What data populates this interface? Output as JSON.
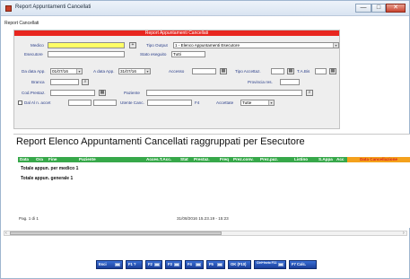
{
  "window": {
    "title": "Report Appuntamenti Cancellati",
    "min": "—",
    "max": "□",
    "close": "✕"
  },
  "subtitle": "Report Cancellati",
  "form": {
    "header": "Report Appuntamenti Cancellati",
    "medico_label": "Medico",
    "medico_value": "",
    "tipo_output_label": "Tipo Output",
    "tipo_output_value": "1 - Elenco Appuntamenti Esecutore",
    "esecutore_label": "Esecutore",
    "esecutore_value": "",
    "stato_label": "Stato eseguito",
    "stato_value": "Tutti",
    "da_data_label": "Da data App.",
    "da_data_value": "01/07/16",
    "a_data_label": "A data App.",
    "a_data_value": "31/07/16",
    "accesso_label": "Accesso",
    "accesso_value": "",
    "tipo_accett_label": "Tipo Accettaz.",
    "tipo_accett_value": "",
    "ta_bis_label": "T.A.Bis",
    "ta_bis_value": "",
    "branca_label": "Branca",
    "branca_value": "",
    "provincia_label": "Provincia res.",
    "provincia_value": "",
    "cod_prestaz_label": "Cod.Prestaz.",
    "cod_prestaz_value": "",
    "paziente_label": "Paziente",
    "paziente_value": "",
    "dal_al_label": "Dal Al n. accet",
    "utente_canc_label": "Utente Canc.",
    "utente_canc_value": "",
    "f4_label": "F4",
    "accettate_label": "Accettate",
    "accettate_value": "Tutte",
    "plus_btn": "+",
    "calendar_glyph": "▦",
    "search_glyph": "⌕",
    "dropdown_glyph": "▾"
  },
  "report": {
    "title": "Report Elenco Appuntamenti Cancellati raggruppati per Esecutore",
    "columns": [
      "Data",
      "Ora",
      "Fine",
      "Paziente",
      "Acces.T.Acc.",
      "Stat",
      "Prestaz.",
      "Freq",
      "Prez.conv.",
      "Prez.paz.",
      "Listino",
      "S.Appa",
      "Acc",
      "Data Cancellazione"
    ],
    "total_medico": "Totale appun. per medico  1",
    "total_generale": "Totale appun. generale  1",
    "page": "Pag. 1 di 1",
    "timestamp": "31/08/2016 15.23.19 - 15:23"
  },
  "scroll": {
    "left": "‹",
    "right": "›"
  },
  "toolbar": {
    "esci": "Esci",
    "f1": "F1 ?",
    "f2": "F2",
    "f3": "F3",
    "f4": "F4",
    "f5": "F5",
    "ok": "OK (F10)",
    "ctrl": "Ctrl+Invio F11",
    "f7": "F7 Calc."
  },
  "colors": {
    "header_red": "#e8261f",
    "column_green": "#37a84a",
    "highlight_yellow": "#ffff66",
    "toolbar_blue": "#1b3f9a"
  }
}
